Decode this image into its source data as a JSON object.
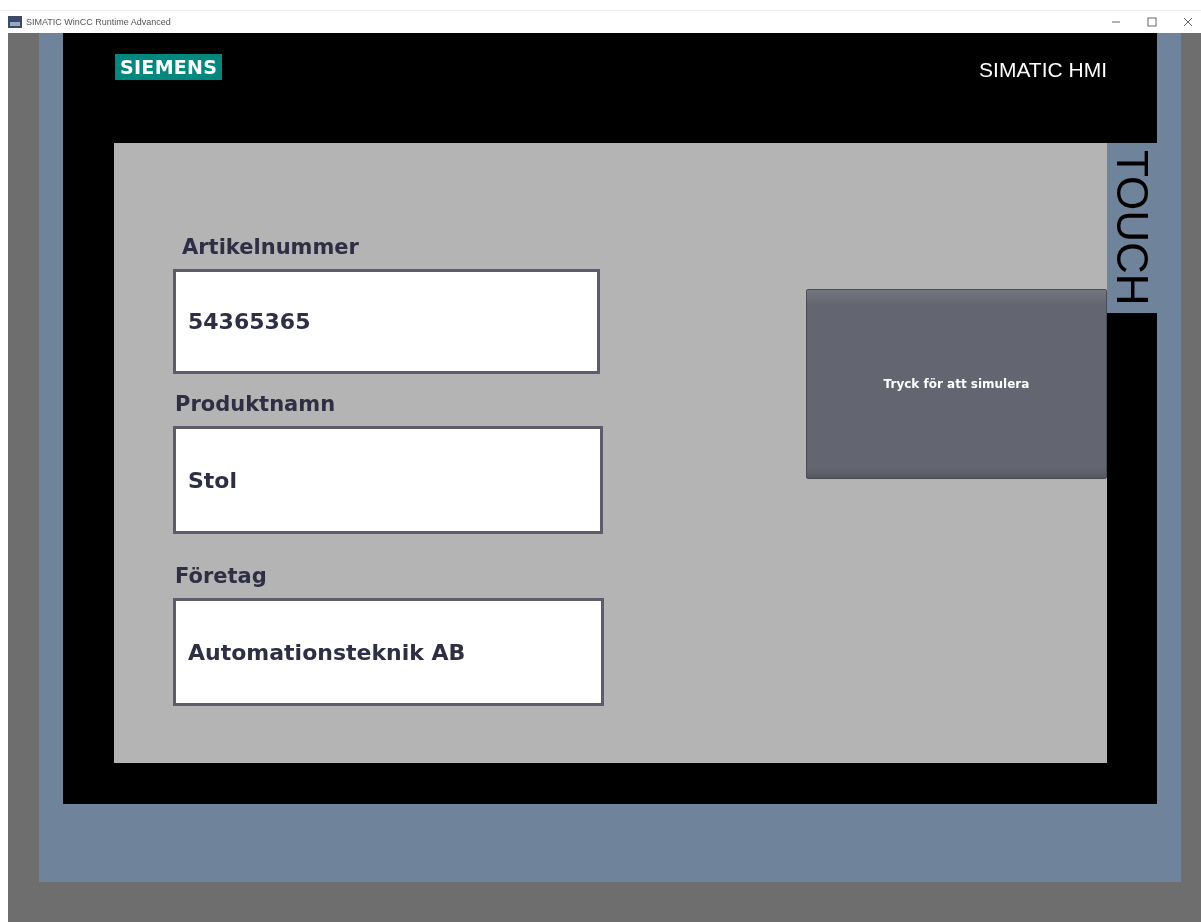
{
  "window": {
    "title": "SIMATIC WinCC Runtime Advanced"
  },
  "device": {
    "logo": "SIEMENS",
    "product": "SIMATIC HMI",
    "side_label": "TOUCH"
  },
  "fields": [
    {
      "label": "Artikelnummer",
      "value": "54365365"
    },
    {
      "label": "Produktnamn",
      "value": "Stol"
    },
    {
      "label": "Företag",
      "value": "Automationsteknik AB"
    }
  ],
  "button": {
    "label": "Tryck för att simulera"
  }
}
